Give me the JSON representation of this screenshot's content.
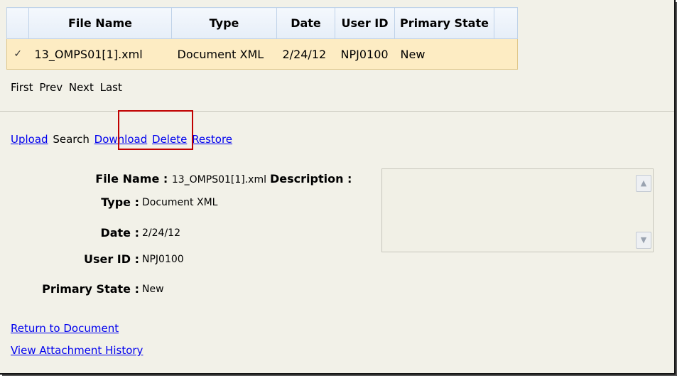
{
  "grid": {
    "headers": [
      "",
      "File Name",
      "Type",
      "Date",
      "User ID",
      "Primary State",
      ""
    ],
    "rows": [
      {
        "check": "✓",
        "file_name": "13_OMPS01[1].xml",
        "type": "Document XML",
        "date": "2/24/12",
        "user_id": "NPJ0100",
        "primary_state": "New"
      }
    ]
  },
  "pager": {
    "first": "First",
    "prev": "Prev",
    "next": "Next",
    "last": "Last"
  },
  "actions": {
    "upload": "Upload",
    "search": "Search",
    "download": "Download",
    "delete": "Delete",
    "restore": "Restore"
  },
  "details": {
    "file_name_label": "File Name :",
    "file_name": "13_OMPS01[1].xml",
    "type_label": "Type :",
    "type": "Document XML",
    "date_label": "Date :",
    "date": "2/24/12",
    "user_id_label": "User ID :",
    "user_id": "NPJ0100",
    "primary_state_label": "Primary State :",
    "primary_state": "New",
    "description_label": "Description :",
    "description": ""
  },
  "links": {
    "return": "Return to Document",
    "history": "View Attachment History"
  },
  "colors": {
    "highlight_box": "#c00000",
    "selected_row": "#fdecc3",
    "link": "#0000ee"
  }
}
